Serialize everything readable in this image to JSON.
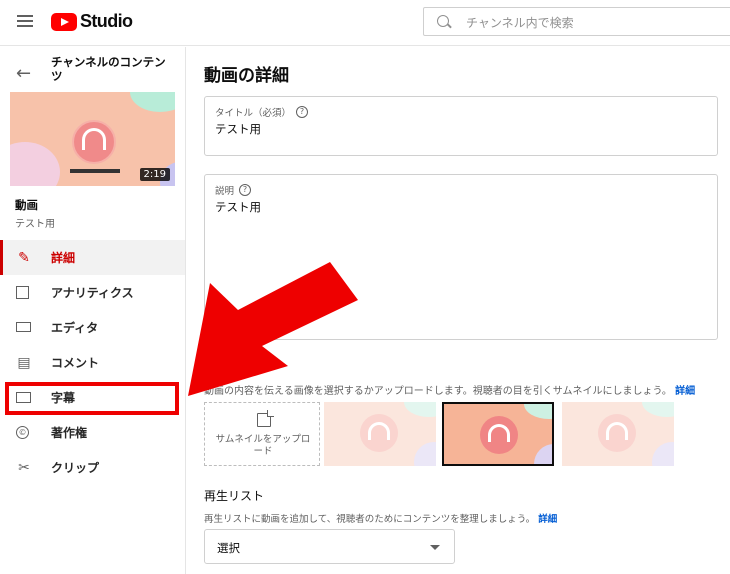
{
  "header": {
    "logo_text": "Studio",
    "search_placeholder": "チャンネル内で検索"
  },
  "sidebar": {
    "channel_title": "チャンネルのコンテンツ",
    "thumbnail_duration": "2:19",
    "video_label": "動画",
    "video_title": "テスト用",
    "items": [
      {
        "label": "詳細",
        "icon": "pencil-icon",
        "active": true
      },
      {
        "label": "アナリティクス",
        "icon": "analytics-icon",
        "active": false
      },
      {
        "label": "エディタ",
        "icon": "editor-icon",
        "active": false
      },
      {
        "label": "コメント",
        "icon": "comment-icon",
        "active": false
      },
      {
        "label": "字幕",
        "icon": "subtitles-icon",
        "active": false
      },
      {
        "label": "著作権",
        "icon": "copyright-icon",
        "active": false
      },
      {
        "label": "クリップ",
        "icon": "scissors-icon",
        "active": false
      }
    ]
  },
  "main": {
    "page_title": "動画の詳細",
    "title_field": {
      "label": "タイトル（必須）",
      "value": "テスト用"
    },
    "description_field": {
      "label": "説明",
      "value": "テスト用"
    },
    "thumbnail_description": "動画の内容を伝える画像を選択するかアップロードします。視聴者の目を引くサムネイルにしましょう。",
    "thumbnail_more": "詳細",
    "upload_thumbnail_label": "サムネイルをアップロード",
    "playlist": {
      "title": "再生リスト",
      "description": "再生リストに動画を追加して、視聴者のためにコンテンツを整理しましょう。",
      "more": "詳細",
      "select_value": "選択"
    }
  },
  "annotation": {
    "highlight_color": "#ee0000",
    "arrow_color": "#ee0000"
  }
}
